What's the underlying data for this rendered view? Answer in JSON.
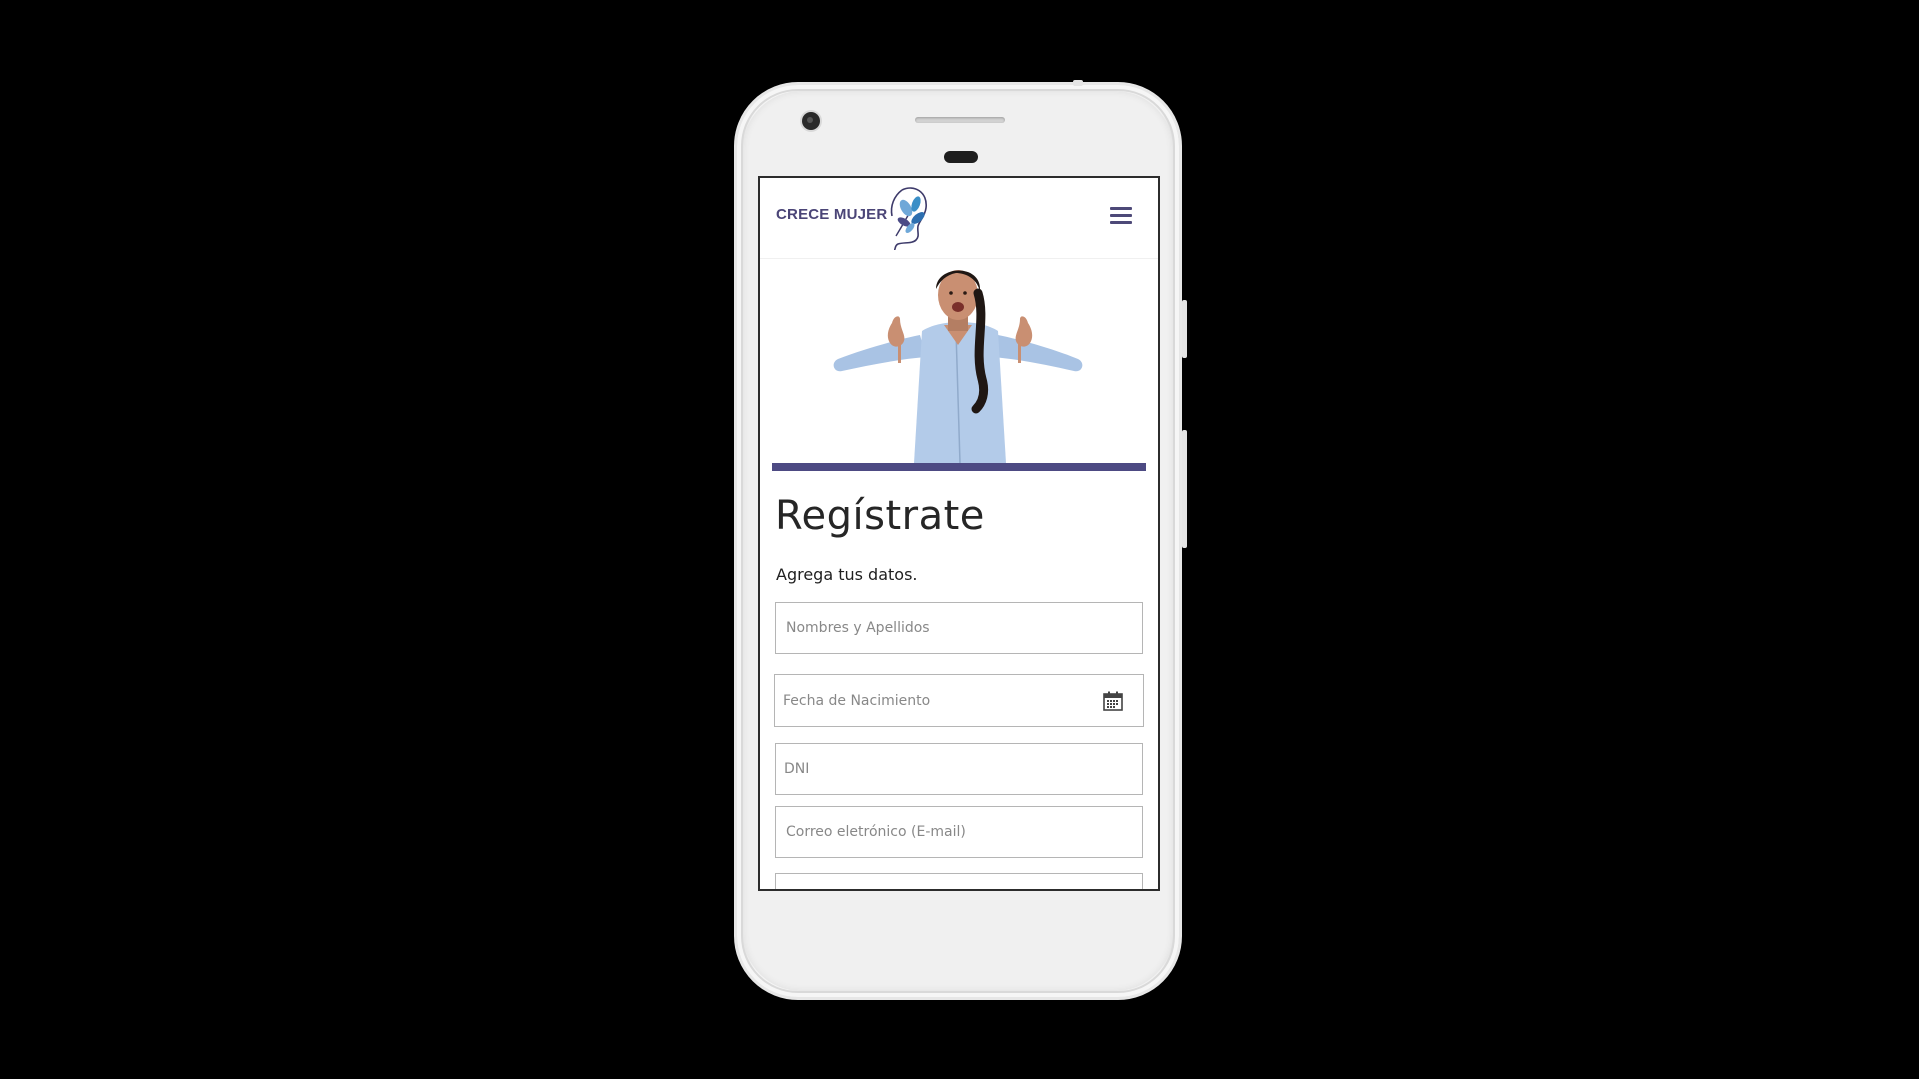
{
  "brand": {
    "name": "CRECE MUJER",
    "accent": "#4d4a83"
  },
  "header": {
    "menu_icon": "hamburger-menu-icon"
  },
  "hero": {
    "image": "woman-pointing-down-photo"
  },
  "form": {
    "title": "Regístrate",
    "subtitle": "Agrega tus datos.",
    "fields": {
      "name_placeholder": "Nombres y Apellidos",
      "birth_placeholder": "Fecha de Nacimiento",
      "dni_placeholder": "DNI",
      "email_placeholder": "Correo eletrónico (E-mail)"
    },
    "calendar_icon": "calendar-icon"
  }
}
